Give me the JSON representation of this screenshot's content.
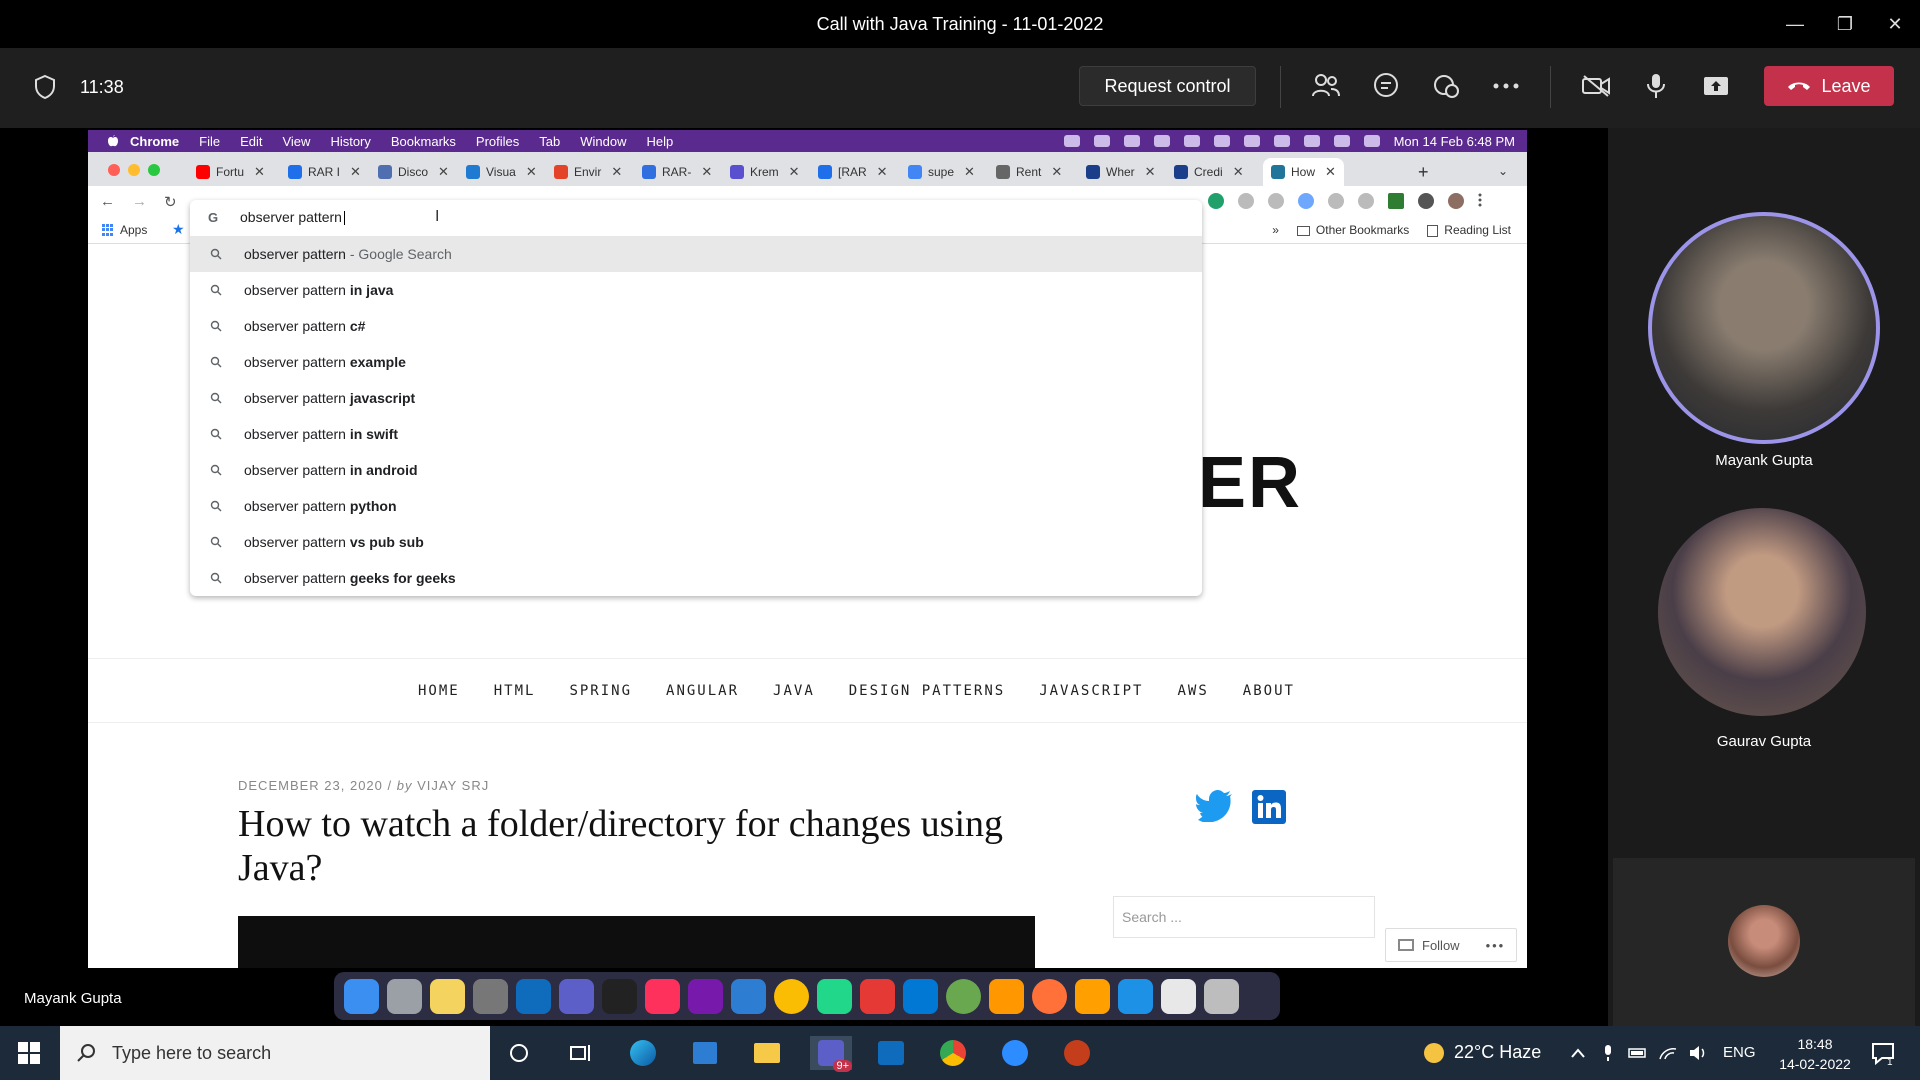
{
  "teams": {
    "window_title": "Call with Java Training - 11-01-2022",
    "call_timer": "11:38",
    "request_control_label": "Request control",
    "leave_label": "Leave",
    "presenter_name": "Mayank Gupta",
    "participants": [
      {
        "name": "Mayank Gupta"
      },
      {
        "name": "Gaurav Gupta"
      }
    ]
  },
  "mac_menubar": {
    "items": [
      "Chrome",
      "File",
      "Edit",
      "View",
      "History",
      "Bookmarks",
      "Profiles",
      "Tab",
      "Window",
      "Help"
    ],
    "datetime": "Mon 14 Feb  6:48 PM"
  },
  "chrome": {
    "tabs": [
      {
        "label": "Fortu",
        "color": "#ff0000"
      },
      {
        "label": "RAR I",
        "color": "#1f6feb"
      },
      {
        "label": "Disco",
        "color": "#4f6fb0"
      },
      {
        "label": "Visua",
        "color": "#1f7ad1"
      },
      {
        "label": "Envir",
        "color": "#e24329"
      },
      {
        "label": "RAR-",
        "color": "#2f6fdf"
      },
      {
        "label": "Krem",
        "color": "#5a4fcf"
      },
      {
        "label": "[RAR",
        "color": "#1f6feb"
      },
      {
        "label": "supe",
        "color": "#4285f4"
      },
      {
        "label": "Rent",
        "color": "#666666"
      },
      {
        "label": "Wher",
        "color": "#1a3e8a"
      },
      {
        "label": "Credi",
        "color": "#1a3e8a"
      },
      {
        "label": "How",
        "color": "#21759b"
      }
    ],
    "omnibox": {
      "typed": "observer pattern",
      "suggestions": [
        {
          "prefix": "observer pattern",
          "bold": "",
          "hint": " - Google Search"
        },
        {
          "prefix": "observer pattern ",
          "bold": "in java",
          "hint": ""
        },
        {
          "prefix": "observer pattern ",
          "bold": "c#",
          "hint": ""
        },
        {
          "prefix": "observer pattern ",
          "bold": "example",
          "hint": ""
        },
        {
          "prefix": "observer pattern ",
          "bold": "javascript",
          "hint": ""
        },
        {
          "prefix": "observer pattern ",
          "bold": "in swift",
          "hint": ""
        },
        {
          "prefix": "observer pattern ",
          "bold": "in android",
          "hint": ""
        },
        {
          "prefix": "observer pattern ",
          "bold": "python",
          "hint": ""
        },
        {
          "prefix": "observer pattern ",
          "bold": "vs pub sub",
          "hint": ""
        },
        {
          "prefix": "observer pattern ",
          "bold": "geeks for geeks",
          "hint": ""
        }
      ]
    },
    "bookmarks": {
      "apps_label": "Apps",
      "overflow": "»",
      "other_bookmarks": "Other Bookmarks",
      "reading_list": "Reading List"
    }
  },
  "page": {
    "logo_fragment": "ER",
    "nav": [
      "HOME",
      "HTML",
      "SPRING",
      "ANGULAR",
      "JAVA",
      "DESIGN PATTERNS",
      "JAVASCRIPT",
      "AWS",
      "ABOUT"
    ],
    "post_date": "DECEMBER 23, 2020",
    "post_sep": " / ",
    "post_by": "by",
    "post_author": "VIJAY SRJ",
    "post_title": "How to watch a folder/directory for changes using Java?",
    "search_placeholder": "Search ...",
    "follow_label": "Follow"
  },
  "taskbar": {
    "search_placeholder": "Type here to search",
    "weather": "22°C  Haze",
    "language": "ENG",
    "time": "18:48",
    "date": "14-02-2022",
    "teams_badge": "9+",
    "notification_count": "1"
  },
  "colors": {
    "leave_red": "#c4314b",
    "mac_menubar": "#5b2a8e",
    "taskbar": "#1c2a3a"
  }
}
